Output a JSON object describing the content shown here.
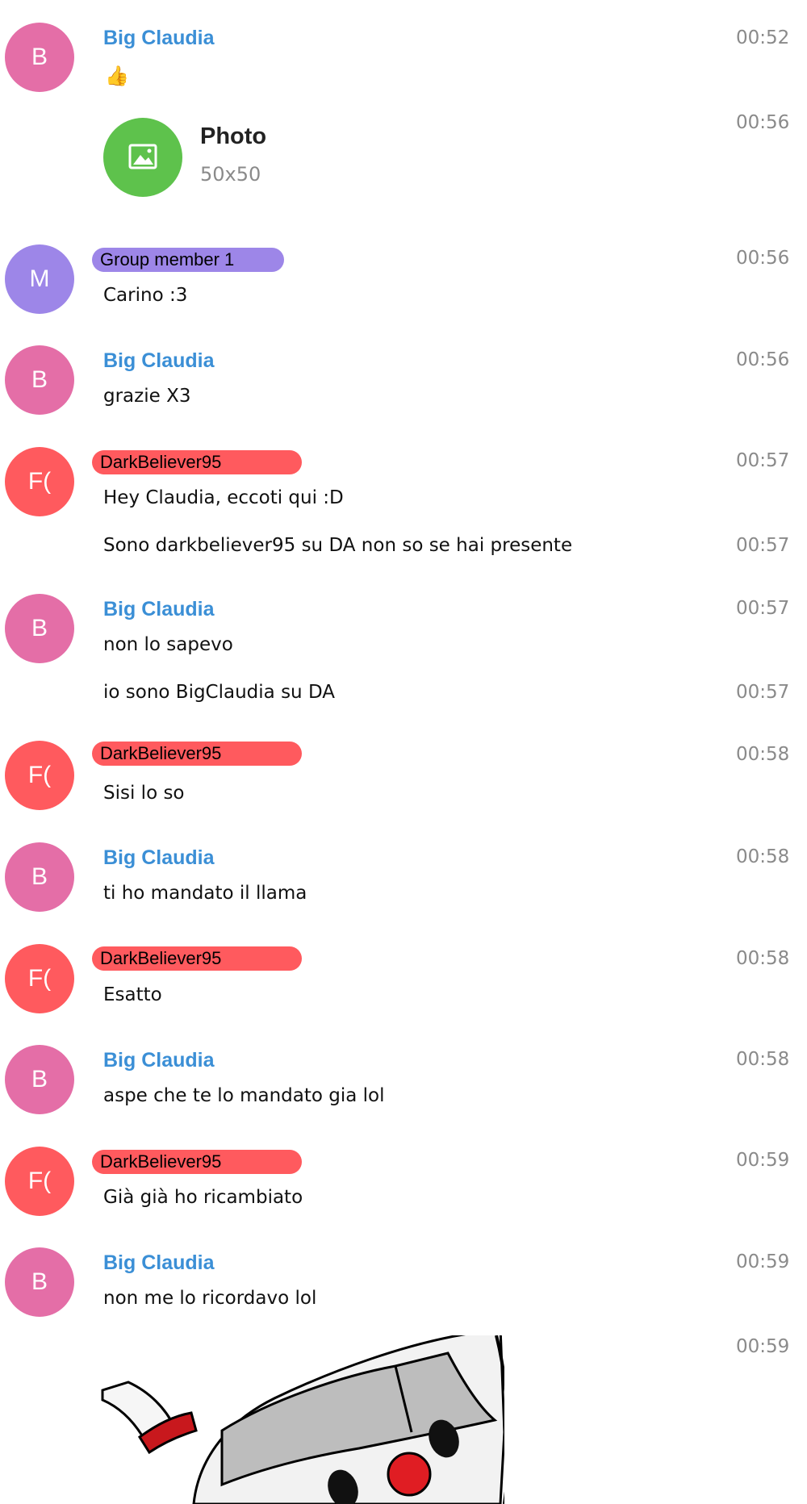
{
  "colors": {
    "big_claudia_avatar": "#e46ea7",
    "group_member_avatar": "#9d86e8",
    "darkbeliever_avatar": "#ff5a5e",
    "name_blue": "#3b8fd6",
    "photo_green": "#5ec24c",
    "time_gray": "#8a8a8a"
  },
  "messages": [
    {
      "avatar": "B",
      "sender": "Big Claudia",
      "text": "",
      "emoji": "thumbs-up",
      "time": "00:52"
    },
    {
      "photo_title": "Photo",
      "photo_size": "50x50",
      "time": "00:56"
    },
    {
      "avatar": "M",
      "sender": "Group member 1",
      "text": "Carino :3",
      "time": "00:56"
    },
    {
      "avatar": "B",
      "sender": "Big Claudia",
      "text": "grazie X3",
      "time": "00:56"
    },
    {
      "avatar": "F(",
      "sender": "DarkBeliever95",
      "text": "Hey Claudia, eccoti qui :D",
      "time": "00:57"
    },
    {
      "text": "Sono darkbeliever95 su DA non so se hai presente",
      "time": "00:57"
    },
    {
      "avatar": "B",
      "sender": "Big Claudia",
      "text": "non lo sapevo",
      "time": "00:57"
    },
    {
      "text": "io sono BigClaudia su DA",
      "time": "00:57"
    },
    {
      "avatar": "F(",
      "sender": "DarkBeliever95",
      "text": "Sisi lo so",
      "time": "00:58"
    },
    {
      "avatar": "B",
      "sender": "Big Claudia",
      "text": "ti ho mandato il llama",
      "time": "00:58"
    },
    {
      "avatar": "F(",
      "sender": "DarkBeliever95",
      "text": "Esatto",
      "time": "00:58"
    },
    {
      "avatar": "B",
      "sender": "Big Claudia",
      "text": "aspe che te lo mandato gia lol",
      "time": "00:58"
    },
    {
      "avatar": "F(",
      "sender": "DarkBeliever95",
      "text": "Già già ho ricambiato",
      "time": "00:59"
    },
    {
      "avatar": "B",
      "sender": "Big Claudia",
      "text": "non me lo ricordavo lol",
      "time": "00:59"
    },
    {
      "sticker": "cuphead-sticker",
      "time": "00:59"
    }
  ]
}
